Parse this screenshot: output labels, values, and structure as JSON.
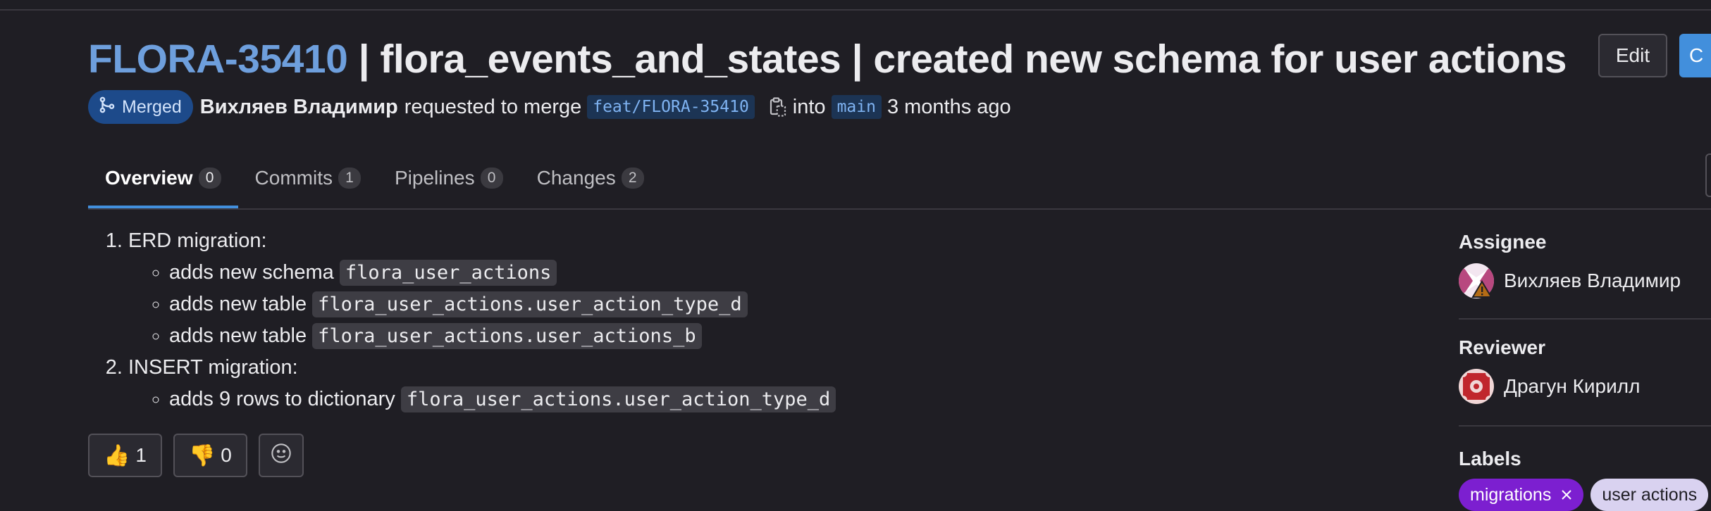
{
  "header": {
    "issue_key": "FLORA-35410",
    "title_rest": " | flora_events_and_states | created new schema for user actions",
    "edit_label": "Edit",
    "code_label": "C"
  },
  "meta": {
    "status": "Merged",
    "author": "Вихляев Владимир",
    "requested_text": "requested to merge",
    "source_branch": "feat/FLORA-35410",
    "into_text": "into",
    "target_branch": "main",
    "time_ago": "3 months ago"
  },
  "tabs": [
    {
      "label": "Overview",
      "count": "0"
    },
    {
      "label": "Commits",
      "count": "1"
    },
    {
      "label": "Pipelines",
      "count": "0"
    },
    {
      "label": "Changes",
      "count": "2"
    }
  ],
  "description": {
    "item1": {
      "heading": "ERD migration:",
      "sub": [
        {
          "text": "adds new schema ",
          "code": "flora_user_actions"
        },
        {
          "text": "adds new table ",
          "code": "flora_user_actions.user_action_type_d"
        },
        {
          "text": "adds new table ",
          "code": "flora_user_actions.user_actions_b"
        }
      ]
    },
    "item2": {
      "heading": "INSERT migration:",
      "sub": [
        {
          "text": "adds 9 rows to dictionary ",
          "code": "flora_user_actions.user_action_type_d"
        }
      ]
    }
  },
  "reactions": {
    "thumbs_up_emoji": "👍",
    "thumbs_up_count": "1",
    "thumbs_down_emoji": "👎",
    "thumbs_down_count": "0"
  },
  "sidebar": {
    "assignee_title": "Assignee",
    "assignee_name": "Вихляев Владимир",
    "reviewer_title": "Reviewer",
    "reviewer_name": "Драгун Кирилл",
    "labels_title": "Labels",
    "labels": [
      "migrations",
      "user actions"
    ]
  },
  "colors": {
    "background": "#1f1e24",
    "link": "#6e9fdd",
    "accent": "#428fdc",
    "merged_badge": "#1d4a8a",
    "label_purple": "#7c1fd0",
    "label_light": "#d9d2f0"
  }
}
